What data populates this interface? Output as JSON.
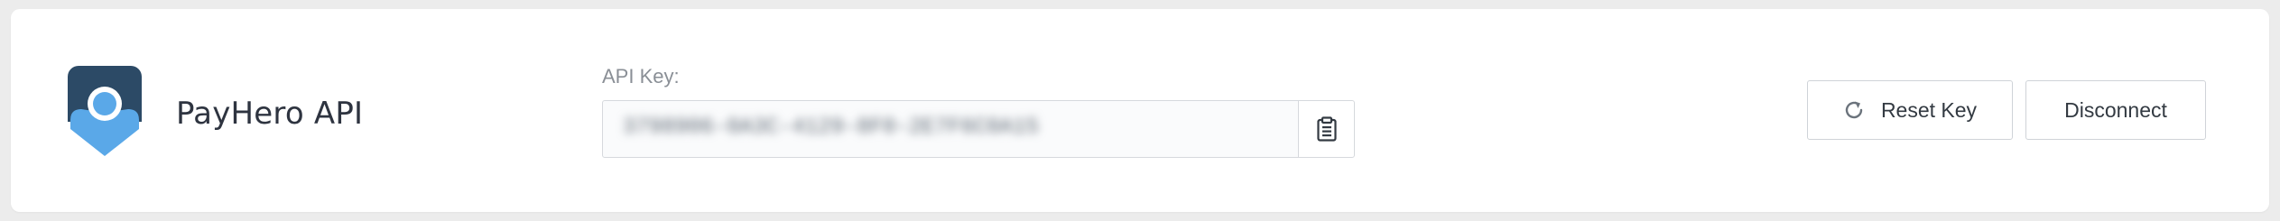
{
  "integration": {
    "name": "PayHero API",
    "logo_icon": "payhero-logo-icon",
    "brand_colors": {
      "dark": "#2c4a66",
      "light": "#5aa8e8"
    }
  },
  "api_key": {
    "label": "API Key:",
    "value": "3798906-0A3C-4129-8F0-2E7F6C0A15",
    "masked": true,
    "copy_icon": "clipboard-icon"
  },
  "actions": {
    "reset_label": "Reset Key",
    "reset_icon": "refresh-icon",
    "disconnect_label": "Disconnect"
  }
}
